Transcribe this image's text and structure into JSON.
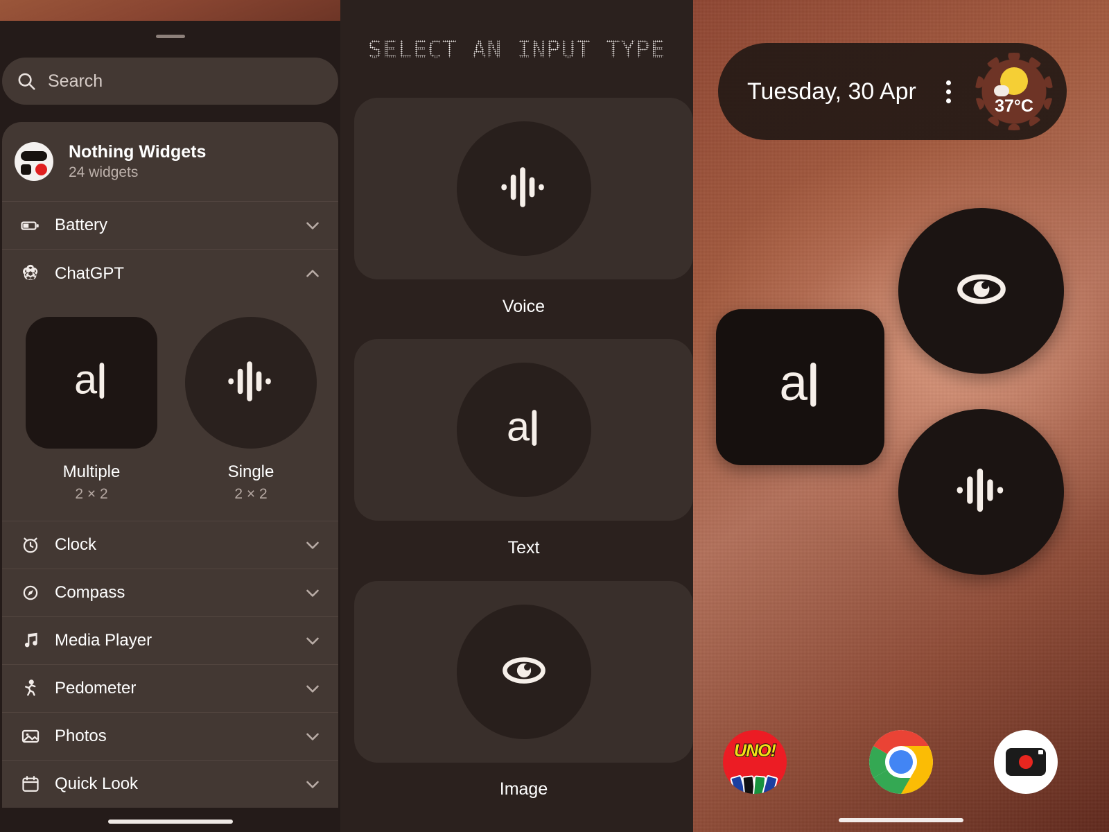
{
  "widget_picker": {
    "search": {
      "placeholder": "Search",
      "icon": "search-icon"
    },
    "app": {
      "name": "Nothing Widgets",
      "count_label": "24 widgets",
      "icon": "nothing-widgets-logo"
    },
    "categories": [
      {
        "label": "Battery",
        "icon": "battery-icon",
        "expanded": false,
        "chevron": "chevron-down-icon"
      },
      {
        "label": "ChatGPT",
        "icon": "chatgpt-icon",
        "expanded": true,
        "chevron": "chevron-up-icon"
      },
      {
        "label": "Clock",
        "icon": "alarm-clock-icon",
        "expanded": false,
        "chevron": "chevron-down-icon"
      },
      {
        "label": "Compass",
        "icon": "compass-icon",
        "expanded": false,
        "chevron": "chevron-down-icon"
      },
      {
        "label": "Media Player",
        "icon": "music-note-icon",
        "expanded": false,
        "chevron": "chevron-down-icon"
      },
      {
        "label": "Pedometer",
        "icon": "walking-person-icon",
        "expanded": false,
        "chevron": "chevron-down-icon"
      },
      {
        "label": "Photos",
        "icon": "photo-icon",
        "expanded": false,
        "chevron": "chevron-down-icon"
      },
      {
        "label": "Quick Look",
        "icon": "calendar-icon",
        "expanded": false,
        "chevron": "chevron-down-icon"
      }
    ],
    "chatgpt_widgets": [
      {
        "name": "Multiple",
        "size": "2 × 2",
        "shape": "square",
        "icon": "text-cursor-icon"
      },
      {
        "name": "Single",
        "size": "2 × 2",
        "shape": "circle",
        "icon": "voice-waveform-icon"
      }
    ]
  },
  "input_picker": {
    "title": "SELECT AN INPUT TYPE",
    "options": [
      {
        "label": "Voice",
        "icon": "voice-waveform-icon"
      },
      {
        "label": "Text",
        "icon": "text-cursor-icon"
      },
      {
        "label": "Image",
        "icon": "eye-icon"
      }
    ]
  },
  "home_screen": {
    "date_widget": {
      "date": "Tuesday, 30 Apr",
      "overflow_icon": "kebab-menu-icon",
      "weather": {
        "temperature": "37°C",
        "icon": "sun-cloud-icon"
      }
    },
    "widgets": [
      {
        "name": "ChatGPT Text",
        "shape": "square",
        "icon": "text-cursor-icon"
      },
      {
        "name": "ChatGPT Image",
        "shape": "circle",
        "icon": "eye-icon"
      },
      {
        "name": "ChatGPT Voice",
        "shape": "circle",
        "icon": "voice-waveform-icon"
      }
    ],
    "dock": [
      {
        "name": "UNO!",
        "label": "UNO!",
        "icon": "uno-app-icon"
      },
      {
        "name": "Chrome",
        "label": "",
        "icon": "chrome-icon"
      },
      {
        "name": "Camera",
        "label": "",
        "icon": "camera-icon"
      }
    ]
  },
  "colors": {
    "sheet_bg": "#241b19",
    "row_bg": "#433833",
    "card_bg": "#392f2b",
    "circle_bg": "#281f1c",
    "accent_red": "#e01f1f",
    "wallpaper": "#a35a3e",
    "weather_yellow": "#f5cf35"
  }
}
